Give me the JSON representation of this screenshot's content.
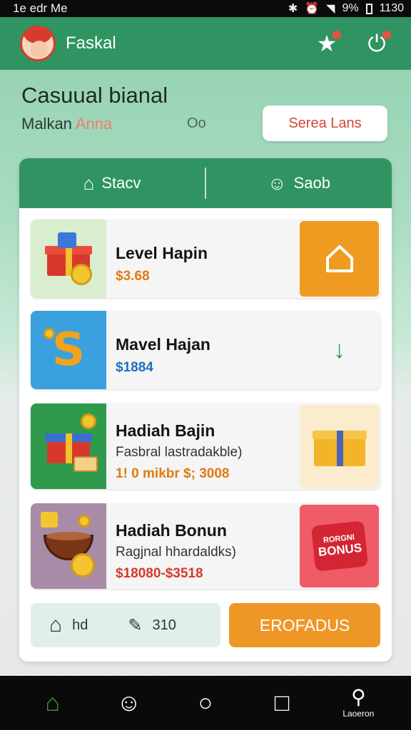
{
  "status_bar": {
    "left_text": "1e edr Me",
    "battery_percent": "9%",
    "time": "1130"
  },
  "header": {
    "title": "Faskal",
    "icons": [
      "avatar",
      "star-icon",
      "power-icon"
    ]
  },
  "hero": {
    "title": "Casuual bianal",
    "subtitle_main": "Malkan",
    "subtitle_accent": "Anna",
    "search_glyph": "Oo",
    "button_label": "Serea Lans"
  },
  "tabs": [
    {
      "label": "Stacv",
      "icon": "house-icon"
    },
    {
      "label": "Saob",
      "icon": "users-icon"
    }
  ],
  "items": [
    {
      "title": "Level Hapin",
      "subtitle": "",
      "price": "$3.68",
      "action_icon": "home-outline-icon",
      "action_color": "#ef9b21"
    },
    {
      "title": "Mavel  Hajan",
      "subtitle": "",
      "price": "$1884",
      "action_icon": "arrow-down-icon",
      "action_color": "#f4f5f4"
    },
    {
      "title": "Hadiah Bajin",
      "subtitle": "Fasbral lastradakble)",
      "price": "1! 0 mikbr $; 3008",
      "action_icon": "gift-icon",
      "action_color": "#fbeccd"
    },
    {
      "title": "Hadiah Bonun",
      "subtitle": "Ragjnal hhardaldks)",
      "price": "$18080-$3518",
      "action_icon": "bonus-badge-icon",
      "action_color": "#ef5b66"
    }
  ],
  "bonus_badge": {
    "line1": "RORGNI",
    "line2": "BONUS"
  },
  "stats": {
    "left_value": "hd",
    "right_value": "310"
  },
  "cta_label": "EROFADUS",
  "nav": [
    {
      "icon": "home-icon",
      "label": ""
    },
    {
      "icon": "profile-icon",
      "label": ""
    },
    {
      "icon": "circle-icon",
      "label": ""
    },
    {
      "icon": "square-icon",
      "label": ""
    },
    {
      "icon": "location-icon",
      "label": "Laoeron"
    }
  ],
  "colors": {
    "brand_green": "#2f9462",
    "orange": "#ee9727",
    "red": "#d0483a",
    "blue": "#1f6ec3"
  }
}
